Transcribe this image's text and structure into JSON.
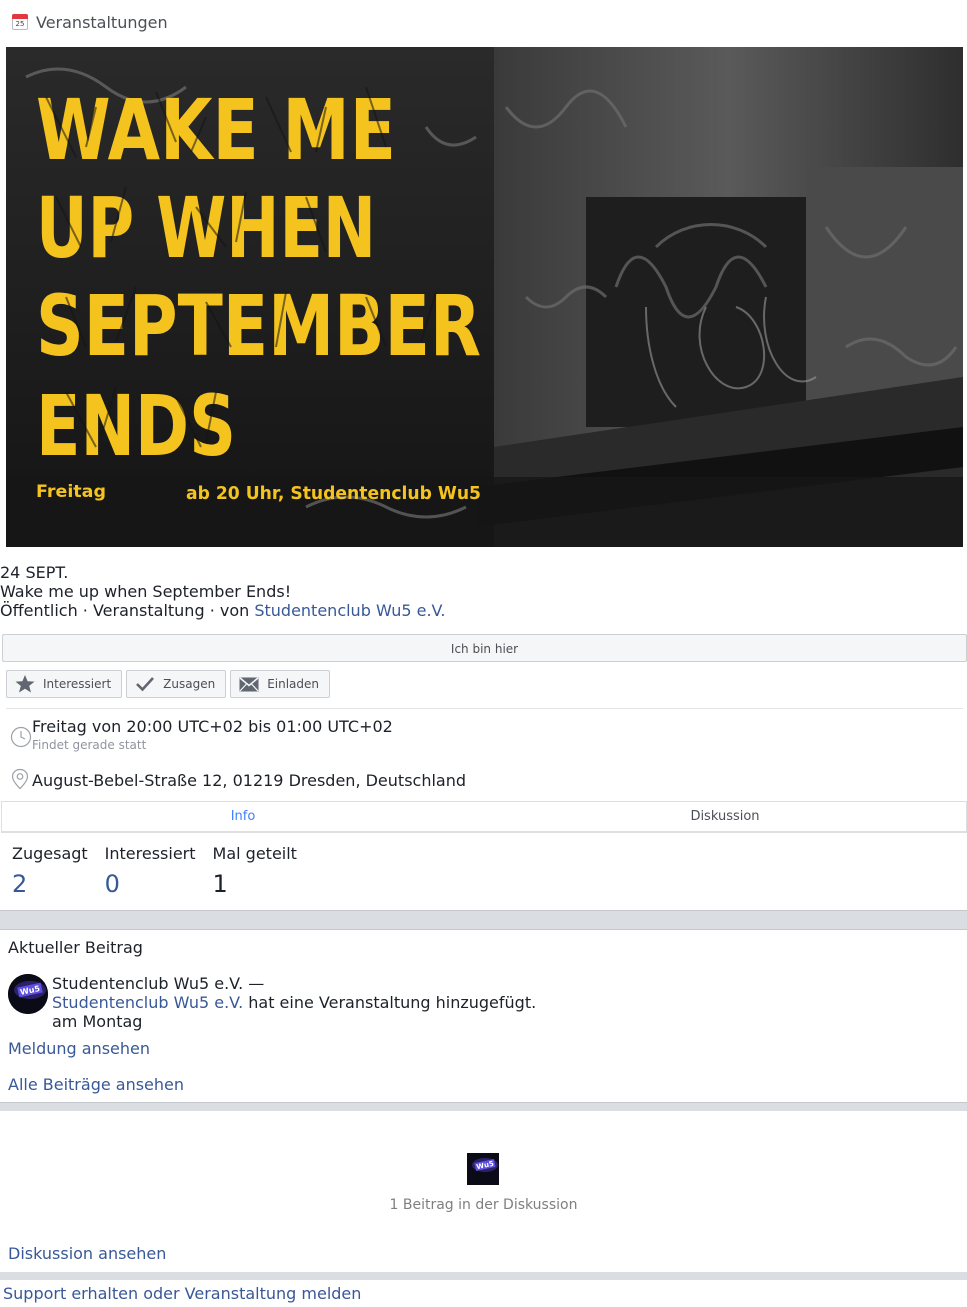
{
  "header": {
    "calendar_day": "25",
    "title": "Veranstaltungen"
  },
  "cover": {
    "title_lines": [
      "WAKE ME",
      "UP WHEN",
      "SEPTEMBER",
      "ENDS"
    ],
    "day_text": "Freitag",
    "details_text": "ab 20 Uhr, Studentenclub Wu5",
    "accent_color": "#f5c31e"
  },
  "event": {
    "date": "24 SEPT.",
    "name": "Wake me up when September Ends!",
    "meta_prefix": "Öffentlich · Veranstaltung · von ",
    "host": "Studentenclub Wu5 e.V."
  },
  "buttons": {
    "here": "Ich bin hier",
    "interested": "Interessiert",
    "going": "Zusagen",
    "invite": "Einladen"
  },
  "details": {
    "time": "Freitag von 20:00 UTC+02 bis 01:00 UTC+02",
    "time_status": "Findet gerade statt",
    "address": "August-Bebel-Straße 12, 01219 Dresden, Deutschland"
  },
  "tabs": {
    "info": "Info",
    "discussion": "Diskussion"
  },
  "stats": [
    {
      "label": "Zugesagt",
      "value": "2"
    },
    {
      "label": "Interessiert",
      "value": "0"
    },
    {
      "label": "Mal geteilt",
      "value": "1"
    }
  ],
  "recent": {
    "title": "Aktueller Beitrag",
    "author_line": "Studentenclub Wu5 e.V. —",
    "actor": "Studentenclub Wu5 e.V.",
    "action": " hat eine Veranstaltung hinzugefügt.",
    "when": "am Montag",
    "view_message": "Meldung ansehen",
    "all_posts": "Alle Beiträge ansehen",
    "avatar_text": "Wu5"
  },
  "discussion": {
    "count_text": "1 Beitrag in der Diskussion",
    "view_link": "Diskussion ansehen"
  },
  "footer": {
    "support_link": "Support erhalten oder Veranstaltung melden"
  }
}
